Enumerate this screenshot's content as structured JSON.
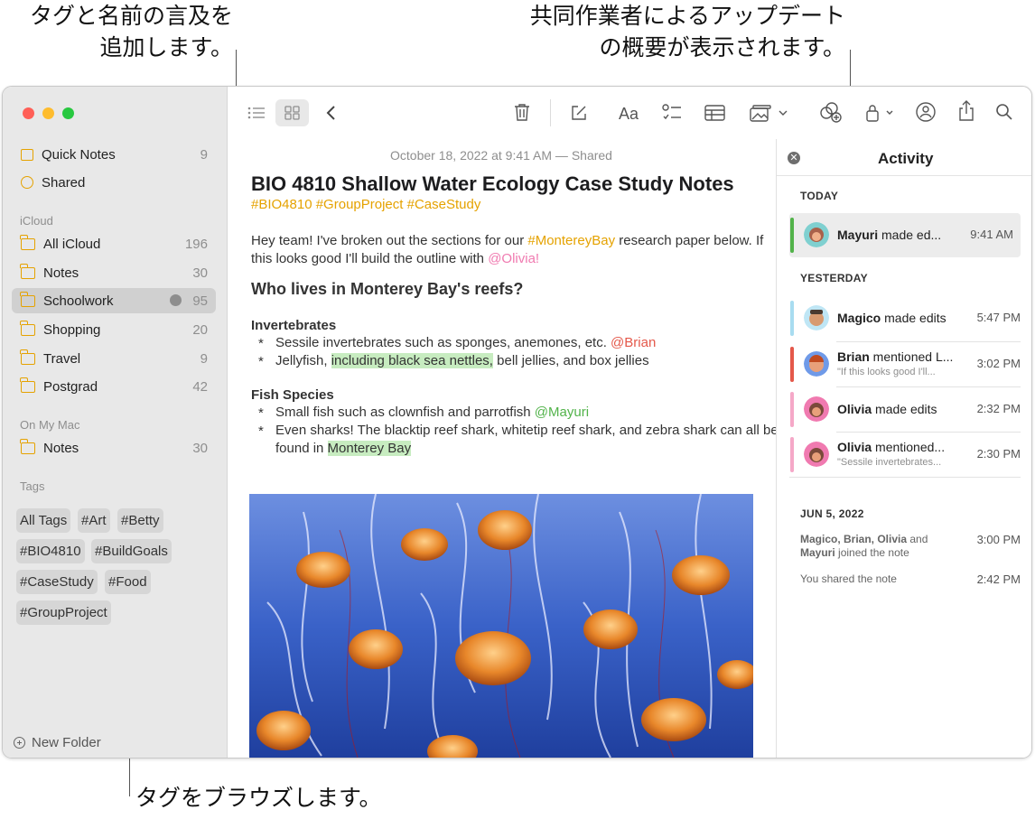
{
  "callouts": {
    "top_left_line1": "タグと名前の言及を",
    "top_left_line2": "追加します。",
    "top_right_line1": "共同作業者によるアップデート",
    "top_right_line2": "の概要が表示されます。",
    "bottom": "タグをブラウズします。"
  },
  "sidebar": {
    "top_items": [
      {
        "label": "Quick Notes",
        "count": "9"
      },
      {
        "label": "Shared",
        "count": ""
      }
    ],
    "icloud_header": "iCloud",
    "icloud_items": [
      {
        "label": "All iCloud",
        "count": "196"
      },
      {
        "label": "Notes",
        "count": "30"
      },
      {
        "label": "Schoolwork",
        "count": "95"
      },
      {
        "label": "Shopping",
        "count": "20"
      },
      {
        "label": "Travel",
        "count": "9"
      },
      {
        "label": "Postgrad",
        "count": "42"
      }
    ],
    "mac_header": "On My Mac",
    "mac_items": [
      {
        "label": "Notes",
        "count": "30"
      }
    ],
    "tags_header": "Tags",
    "tags": [
      "All Tags",
      "#Art",
      "#Betty",
      "#BIO4810",
      "#BuildGoals",
      "#CaseStudy",
      "#Food",
      "#GroupProject"
    ],
    "new_folder": "New Folder"
  },
  "toolbar": {
    "format_label": "Aa"
  },
  "note": {
    "date": "October 18, 2022 at 9:41 AM — Shared",
    "title": "BIO 4810 Shallow Water Ecology Case Study Notes",
    "tags_line": "#BIO4810 #GroupProject #CaseStudy",
    "intro_a": "Hey team! I've broken out the sections for our ",
    "intro_tag": "#MontereyBay",
    "intro_b": " research paper below. If this looks good I'll build the outline with ",
    "intro_mention": "@Olivia!",
    "heading": "Who lives in Monterey Bay's reefs?",
    "sub1": "Invertebrates",
    "b1_text": "Sessile invertebrates such as sponges, anemones, etc. ",
    "b1_mention": "@Brian",
    "b2_a": "Jellyfish, ",
    "b2_hl": "including black sea nettles,",
    "b2_b": " bell jellies, and box jellies",
    "sub2": "Fish Species",
    "b3_text": "Small fish such as clownfish and parrotfish ",
    "b3_mention": "@Mayuri",
    "b4_text": "Even sharks! The blacktip reef shark, whitetip reef shark, and zebra shark can all be found in ",
    "b4_hl": "Monterey Bay"
  },
  "activity": {
    "title": "Activity",
    "today": "TODAY",
    "yesterday": "YESTERDAY",
    "jun": "JUN 5, 2022",
    "rows": [
      {
        "name": "Mayuri",
        "action": " made ed...",
        "sub": "",
        "time": "9:41 AM"
      },
      {
        "name": "Magico",
        "action": " made edits",
        "sub": "",
        "time": "5:47 PM"
      },
      {
        "name": "Brian",
        "action": " mentioned L...",
        "sub": "\"If this looks good I'll...",
        "time": "3:02 PM"
      },
      {
        "name": "Olivia",
        "action": " made edits",
        "sub": "",
        "time": "2:32 PM"
      },
      {
        "name": "Olivia",
        "action": " mentioned...",
        "sub": "\"Sessile invertebrates...",
        "time": "2:30 PM"
      }
    ],
    "joined_names": "Magico, Brian, Olivia",
    "joined_and": " and",
    "joined_line2_name": "Mayuri",
    "joined_line2_rest": " joined the note",
    "joined_time": "3:00 PM",
    "shared_text": "You shared the note",
    "shared_time": "2:42 PM"
  },
  "colors": {
    "tag_accent": "#e5a200",
    "mention_brian": "#e4584a",
    "mention_mayuri": "#52b34a",
    "mention_olivia": "#f07ab0",
    "bar_mayuri": "#52b34a",
    "bar_magico": "#a8dcf0",
    "bar_brian": "#e4584a",
    "bar_olivia": "#f5a8c8"
  }
}
